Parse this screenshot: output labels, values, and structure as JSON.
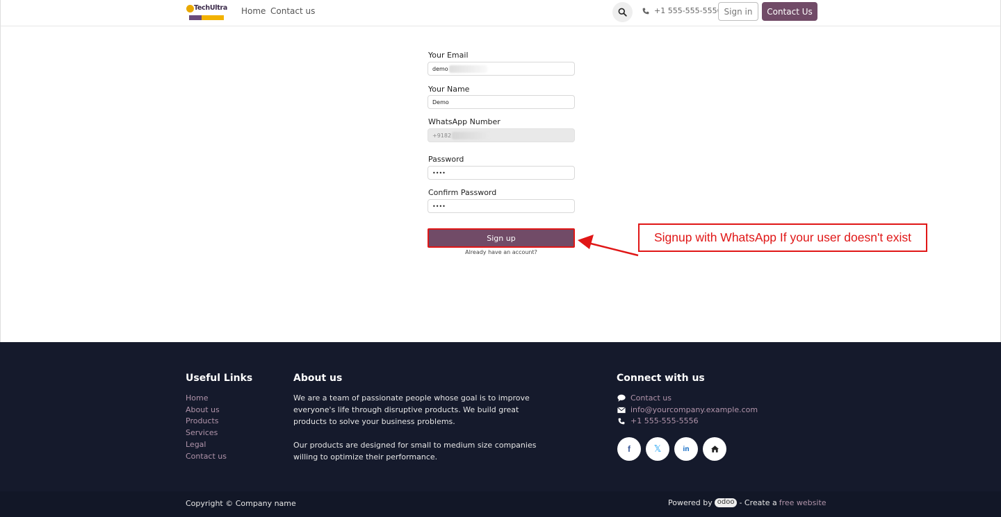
{
  "header": {
    "logo_text": "TechUltra",
    "nav": [
      {
        "label": "Home"
      },
      {
        "label": "Contact us"
      }
    ],
    "phone": "+1 555-555-5556",
    "signin_label": "Sign in",
    "contact_label": "Contact Us"
  },
  "form": {
    "email_label": "Your Email",
    "email_value": "demo",
    "name_label": "Your Name",
    "name_value": "Demo",
    "whatsapp_label": "WhatsApp Number",
    "whatsapp_value": "+9182",
    "password_label": "Password",
    "password_value": "••••",
    "confirm_label": "Confirm Password",
    "confirm_value": "••••",
    "signup_label": "Sign up",
    "already_label": "Already have an account?"
  },
  "annotation": {
    "text": "Signup with WhatsApp If your user doesn't exist",
    "color": "#e01616"
  },
  "footer": {
    "useful_links_title": "Useful Links",
    "useful_links": [
      "Home",
      "About us",
      "Products",
      "Services",
      "Legal",
      "Contact us"
    ],
    "about_title": "About us",
    "about_p1": "We are a team of passionate people whose goal is to improve everyone's life through disruptive products. We build great products to solve your business problems.",
    "about_p2": "Our products are designed for small to medium size companies willing to optimize their performance.",
    "connect_title": "Connect with us",
    "connect_contact": "Contact us",
    "connect_email": "info@yourcompany.example.com",
    "connect_phone": "+1 555-555-5556",
    "social_icons": [
      "facebook-icon",
      "x-icon",
      "linkedin-icon",
      "home-icon"
    ],
    "copyright": "Copyright © Company name",
    "powered_by": "Powered by",
    "odoo": "odoo",
    "create_a": "- Create a",
    "free_website": "free website"
  },
  "colors": {
    "brand": "#714b67",
    "footer_bg": "#151a2c",
    "link": "#b194aa",
    "annotation": "#e01616"
  }
}
